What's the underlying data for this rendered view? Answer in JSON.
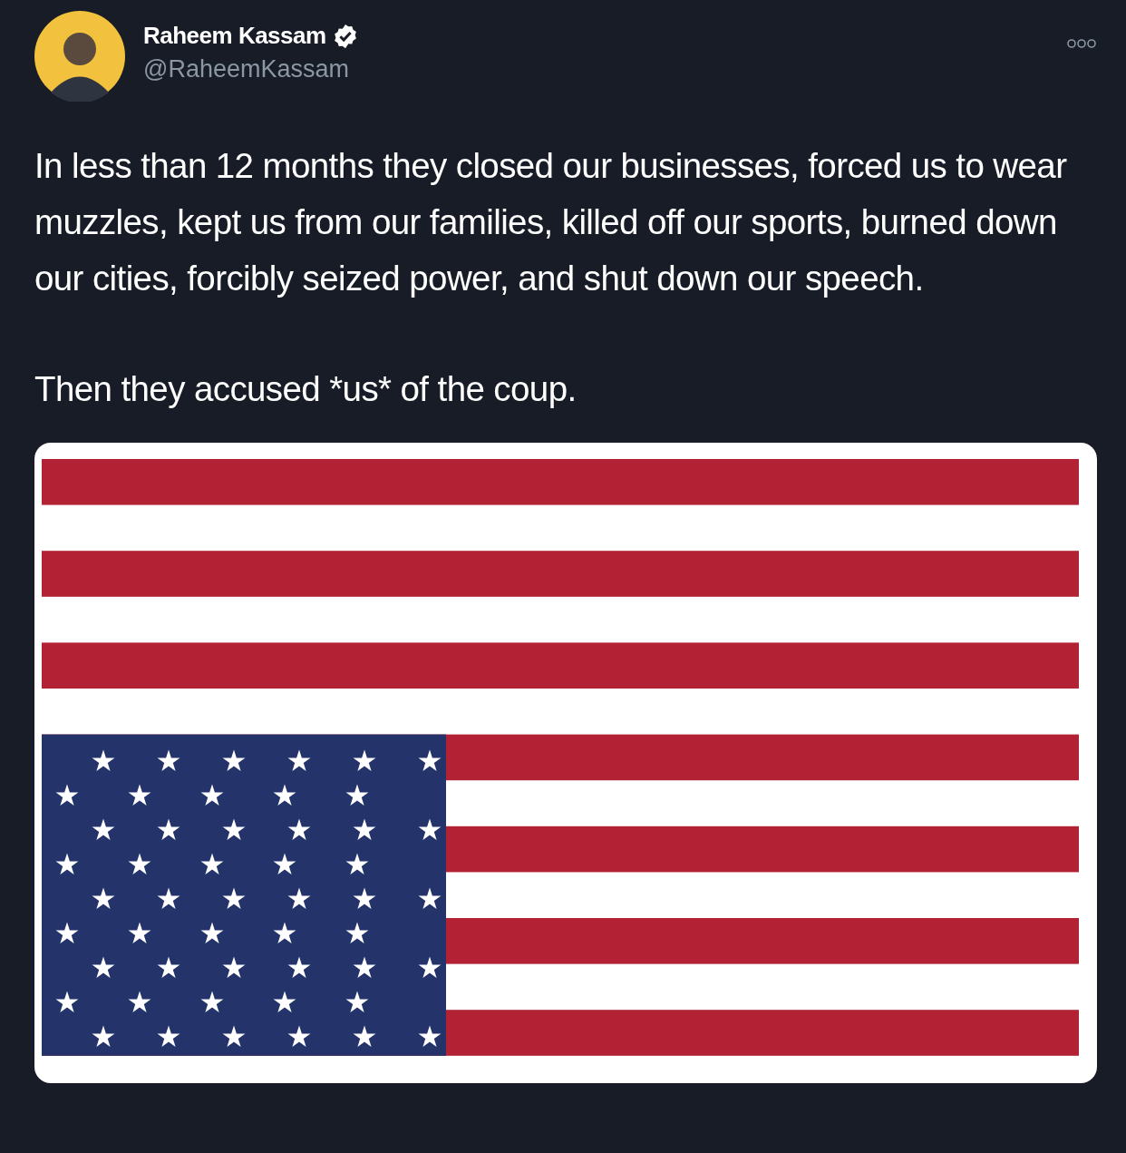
{
  "tweet": {
    "author": {
      "name": "Raheem Kassam",
      "verified": true,
      "handle": "@RaheemKassam"
    },
    "paragraphs": [
      "In less than 12 months they closed our businesses, forced us to wear muzzles, kept us from our families, killed off our sports, burned down our cities, forcibly seized power, and shut down our speech.",
      "Then they accused *us* of the coup."
    ]
  }
}
